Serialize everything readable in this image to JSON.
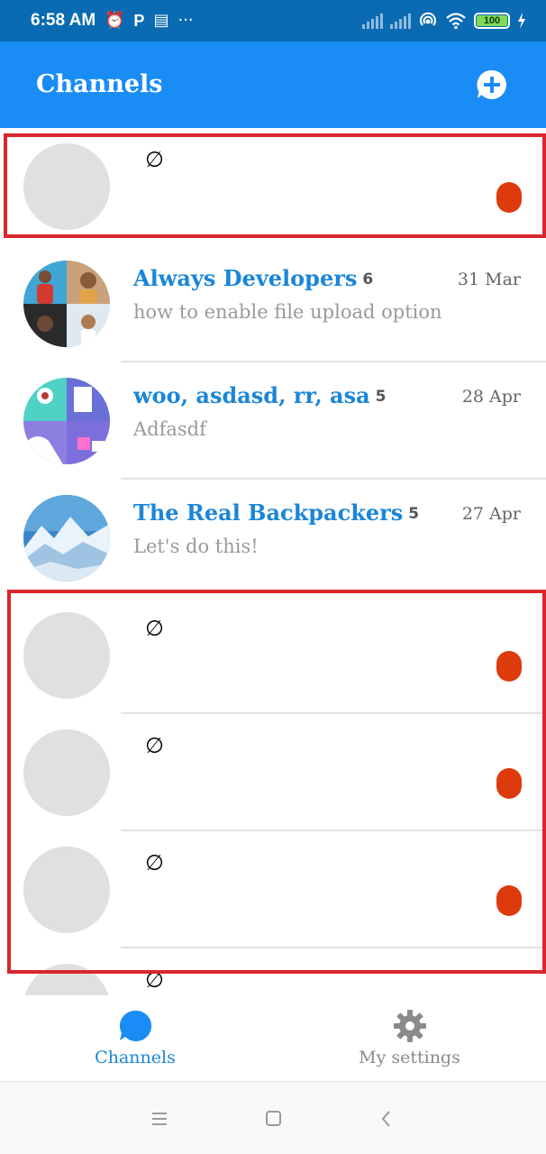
{
  "status_bar": {
    "time": "6:58 AM",
    "left_icons": [
      "alarm-icon",
      "parking-icon",
      "calendar-icon",
      "more-icon"
    ],
    "battery": "100"
  },
  "app_bar": {
    "title": "Channels",
    "action_icon": "new-chat-plus-icon",
    "color": "#1a8cf5"
  },
  "channels": [
    {
      "placeholder": true,
      "empty_symbol": "∅"
    },
    {
      "name": "Always Developers",
      "count": "6",
      "date": "31 Mar",
      "last_message": "how to enable file upload option"
    },
    {
      "name": "woo, asdasd, rr, asa",
      "count": "5",
      "date": "28 Apr",
      "last_message": "Adfasdf"
    },
    {
      "name": "The Real Backpackers",
      "count": "5",
      "date": "27 Apr",
      "last_message": "Let's do this!"
    },
    {
      "placeholder": true,
      "empty_symbol": "∅"
    },
    {
      "placeholder": true,
      "empty_symbol": "∅"
    },
    {
      "placeholder": true,
      "empty_symbol": "∅"
    },
    {
      "placeholder": true,
      "empty_symbol": "∅"
    }
  ],
  "bottom_nav": {
    "items": [
      {
        "label": "Channels",
        "icon": "chat-bubble-icon",
        "active": true
      },
      {
        "label": "My settings",
        "icon": "gear-icon",
        "active": false
      }
    ]
  },
  "system_nav": [
    "menu-icon",
    "home-icon",
    "back-icon"
  ],
  "colors": {
    "accent": "#1a8cf5",
    "channel_name": "#1a86d8",
    "unread_dot": "#dd3b0c",
    "highlight_border": "#d9262c"
  }
}
